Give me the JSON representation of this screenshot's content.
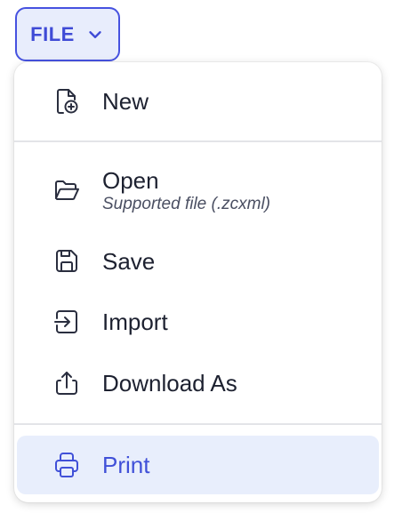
{
  "file_button": {
    "label": "FILE",
    "icon": "chevron-down-icon"
  },
  "menu": {
    "new": {
      "label": "New",
      "icon": "new-file-icon"
    },
    "open": {
      "label": "Open",
      "sublabel": "Supported file (.zcxml)",
      "icon": "folder-open-icon"
    },
    "save": {
      "label": "Save",
      "icon": "save-icon"
    },
    "import": {
      "label": "Import",
      "icon": "import-icon"
    },
    "download_as": {
      "label": "Download As",
      "icon": "download-upload-icon"
    },
    "print": {
      "label": "Print",
      "icon": "printer-icon",
      "highlighted": true
    }
  },
  "colors": {
    "accent": "#4050d8",
    "accent_bg": "#e8edfc",
    "text": "#1d2130",
    "divider": "#e3e4e8"
  }
}
